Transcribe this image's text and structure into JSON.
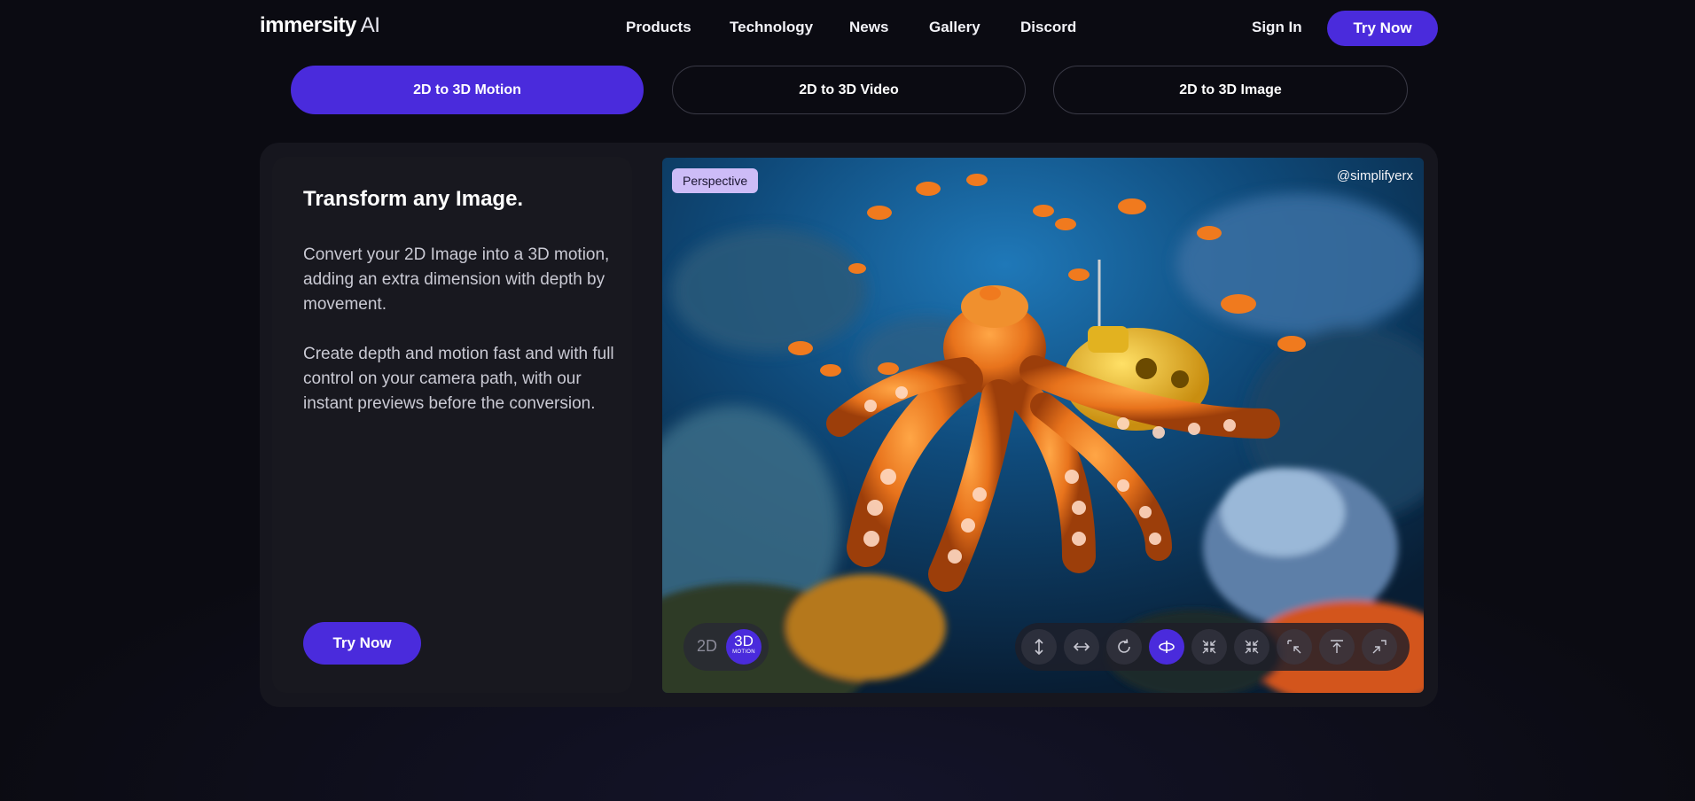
{
  "nav": {
    "logo_brand": "immersity",
    "logo_suffix": "AI",
    "links": [
      "Products",
      "Technology",
      "News",
      "Gallery",
      "Discord"
    ],
    "sign_in": "Sign In",
    "try_now": "Try Now"
  },
  "tabs": [
    {
      "label": "2D to 3D Motion",
      "active": true
    },
    {
      "label": "2D to 3D Video",
      "active": false
    },
    {
      "label": "2D to 3D Image",
      "active": false
    }
  ],
  "card": {
    "title": "Transform any Image.",
    "paragraph_1": "Convert your 2D Image into a 3D motion, adding an extra dimension with depth by movement.",
    "paragraph_2": "Create depth and motion fast and with full control on your camera path, with our instant previews before the conversion.",
    "try_now": "Try Now"
  },
  "preview": {
    "badge": "Perspective",
    "credit": "@simplifyerx",
    "toggle_2d": "2D",
    "toggle_3d": "3D",
    "toggle_3d_sub": "MOTION",
    "motion_controls": [
      {
        "icon": "vertical-arrows-icon",
        "active": false
      },
      {
        "icon": "horizontal-arrows-icon",
        "active": false
      },
      {
        "icon": "rotate-icon",
        "active": false
      },
      {
        "icon": "orbit-icon",
        "active": true
      },
      {
        "icon": "zoom-in-icon",
        "active": false
      },
      {
        "icon": "zoom-in-center-icon",
        "active": false
      },
      {
        "icon": "dolly-zoom-icon",
        "active": false
      },
      {
        "icon": "crane-up-icon",
        "active": false
      },
      {
        "icon": "zoom-out-icon",
        "active": false
      }
    ]
  },
  "colors": {
    "accent": "#4a2bdc",
    "background": "#0b0b12",
    "card": "#16161e",
    "badge": "#cdbcf7"
  }
}
